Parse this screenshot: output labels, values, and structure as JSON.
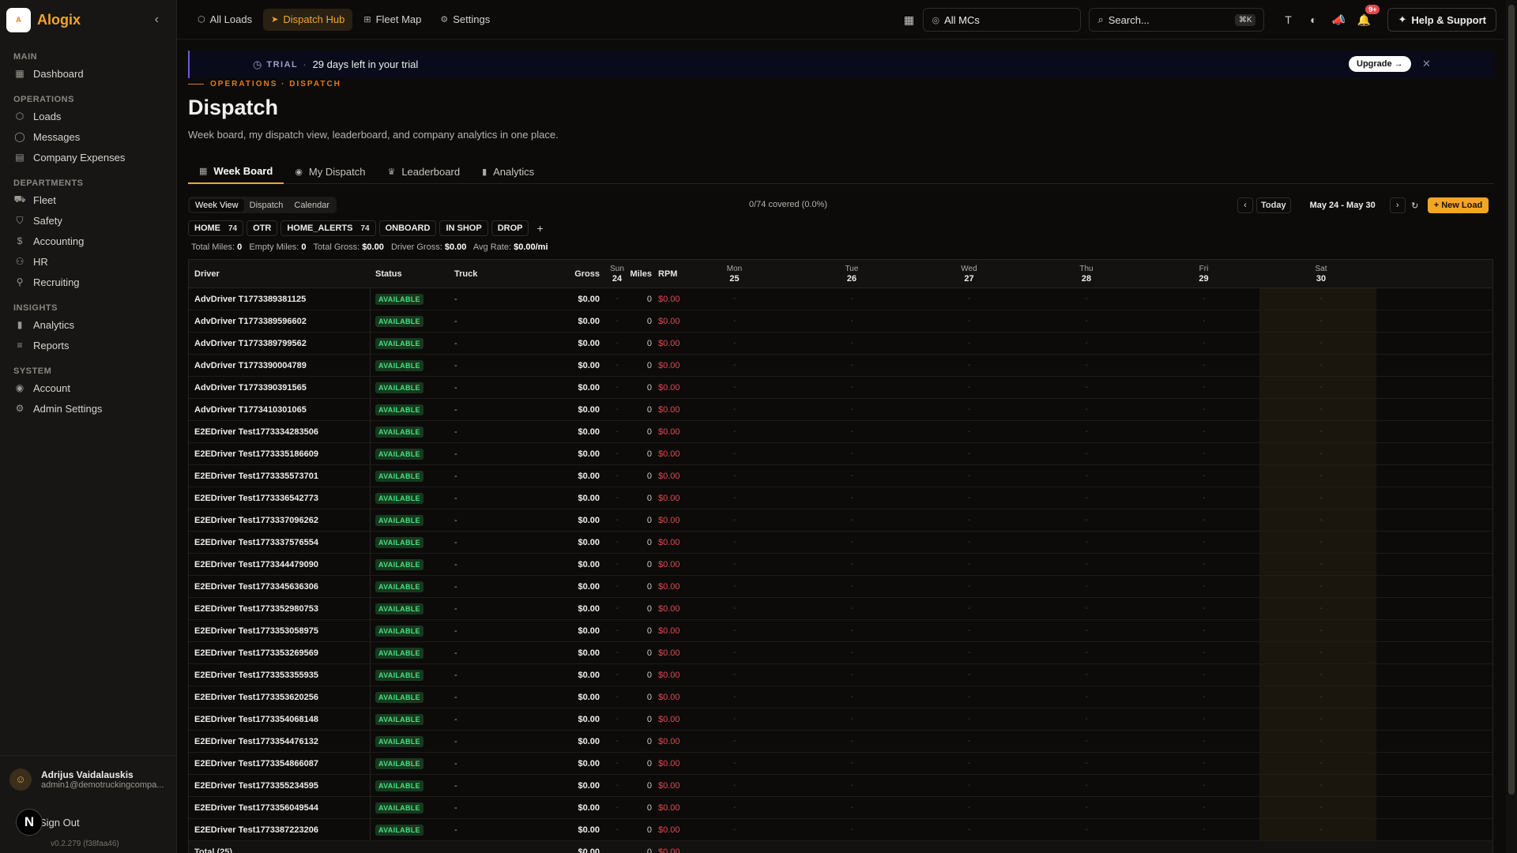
{
  "app": {
    "name": "Alogix",
    "logo_text": "Alogix"
  },
  "sidebar": {
    "sections": [
      {
        "title": "MAIN",
        "items": [
          {
            "label": "Dashboard",
            "icon": "grid-icon"
          }
        ]
      },
      {
        "title": "OPERATIONS",
        "items": [
          {
            "label": "Loads",
            "icon": "package-icon"
          },
          {
            "label": "Messages",
            "icon": "chat-icon"
          },
          {
            "label": "Company Expenses",
            "icon": "receipt-icon"
          }
        ]
      },
      {
        "title": "DEPARTMENTS",
        "items": [
          {
            "label": "Fleet",
            "icon": "truck-icon"
          },
          {
            "label": "Safety",
            "icon": "shield-icon"
          },
          {
            "label": "Accounting",
            "icon": "dollar-icon"
          },
          {
            "label": "HR",
            "icon": "users-icon"
          },
          {
            "label": "Recruiting",
            "icon": "user-plus-icon"
          }
        ]
      },
      {
        "title": "INSIGHTS",
        "items": [
          {
            "label": "Analytics",
            "icon": "bar-chart-icon"
          },
          {
            "label": "Reports",
            "icon": "report-icon"
          }
        ]
      },
      {
        "title": "SYSTEM",
        "items": [
          {
            "label": "Account",
            "icon": "user-circle-icon"
          },
          {
            "label": "Admin Settings",
            "icon": "gear-icon"
          }
        ]
      }
    ],
    "user": {
      "name": "Adrijus Vaidalauskis",
      "email": "admin1@demotruckingcompa..."
    },
    "sign_out": "Sign Out",
    "version": "v0.2.279 (f38faa46)"
  },
  "topnav": {
    "items": [
      {
        "label": "All Loads",
        "icon": "package-icon",
        "active": false
      },
      {
        "label": "Dispatch Hub",
        "icon": "send-icon",
        "active": true
      },
      {
        "label": "Fleet Map",
        "icon": "map-icon",
        "active": false
      },
      {
        "label": "Settings",
        "icon": "gear-icon",
        "active": false
      }
    ],
    "mc_select": "All MCs",
    "search_placeholder": "Search...",
    "search_shortcut": "⌘K",
    "notifications_badge": "9+",
    "help_label": "Help & Support"
  },
  "trial": {
    "tag": "TRIAL",
    "separator": "·",
    "message": "29 days left in your trial",
    "upgrade_label": "Upgrade →"
  },
  "header": {
    "breadcrumb": "OPERATIONS · DISPATCH",
    "title": "Dispatch",
    "subtitle": "Week board, my dispatch view, leaderboard, and company analytics in one place."
  },
  "tabs": [
    {
      "label": "Week Board",
      "icon": "grid-icon",
      "active": true
    },
    {
      "label": "My Dispatch",
      "icon": "user-circle-icon",
      "active": false
    },
    {
      "label": "Leaderboard",
      "icon": "trophy-icon",
      "active": false
    },
    {
      "label": "Analytics",
      "icon": "bar-chart-icon",
      "active": false
    }
  ],
  "view_toggle": [
    {
      "label": "Week View",
      "active": true
    },
    {
      "label": "Dispatch",
      "active": false
    },
    {
      "label": "Calendar",
      "active": false
    }
  ],
  "coverage": "0/74 covered (0.0%)",
  "date_nav": {
    "today": "Today",
    "range": "May 24 - May 30",
    "new_load": "+ New Load"
  },
  "filters": [
    {
      "label": "HOME",
      "count": "74"
    },
    {
      "label": "OTR",
      "count": ""
    },
    {
      "label": "HOME_ALERTS",
      "count": "74"
    },
    {
      "label": "ONBOARD",
      "count": ""
    },
    {
      "label": "IN SHOP",
      "count": ""
    },
    {
      "label": "DROP",
      "count": ""
    }
  ],
  "totals": {
    "total_miles_label": "Total Miles:",
    "total_miles": "0",
    "empty_miles_label": "Empty Miles:",
    "empty_miles": "0",
    "total_gross_label": "Total Gross:",
    "total_gross": "$0.00",
    "driver_gross_label": "Driver Gross:",
    "driver_gross": "$0.00",
    "avg_rate_label": "Avg Rate:",
    "avg_rate": "$0.00/mi"
  },
  "table": {
    "columns": {
      "driver": "Driver",
      "status": "Status",
      "truck": "Truck",
      "gross": "Gross",
      "miles": "Miles",
      "rpm": "RPM"
    },
    "days": [
      {
        "name": "Sun",
        "date": "24"
      },
      {
        "name": "Mon",
        "date": "25"
      },
      {
        "name": "Tue",
        "date": "26"
      },
      {
        "name": "Wed",
        "date": "27"
      },
      {
        "name": "Thu",
        "date": "28"
      },
      {
        "name": "Fri",
        "date": "29"
      },
      {
        "name": "Sat",
        "date": "30"
      }
    ],
    "empty_cell": "-",
    "rows": [
      {
        "driver": "AdvDriver T1773389381125",
        "status": "AVAILABLE",
        "truck": "-",
        "gross": "$0.00",
        "miles": "0",
        "rpm": "$0.00"
      },
      {
        "driver": "AdvDriver T1773389596602",
        "status": "AVAILABLE",
        "truck": "-",
        "gross": "$0.00",
        "miles": "0",
        "rpm": "$0.00"
      },
      {
        "driver": "AdvDriver T1773389799562",
        "status": "AVAILABLE",
        "truck": "-",
        "gross": "$0.00",
        "miles": "0",
        "rpm": "$0.00"
      },
      {
        "driver": "AdvDriver T1773390004789",
        "status": "AVAILABLE",
        "truck": "-",
        "gross": "$0.00",
        "miles": "0",
        "rpm": "$0.00"
      },
      {
        "driver": "AdvDriver T1773390391565",
        "status": "AVAILABLE",
        "truck": "-",
        "gross": "$0.00",
        "miles": "0",
        "rpm": "$0.00"
      },
      {
        "driver": "AdvDriver T1773410301065",
        "status": "AVAILABLE",
        "truck": "-",
        "gross": "$0.00",
        "miles": "0",
        "rpm": "$0.00"
      },
      {
        "driver": "E2EDriver Test1773334283506",
        "status": "AVAILABLE",
        "truck": "-",
        "gross": "$0.00",
        "miles": "0",
        "rpm": "$0.00"
      },
      {
        "driver": "E2EDriver Test1773335186609",
        "status": "AVAILABLE",
        "truck": "-",
        "gross": "$0.00",
        "miles": "0",
        "rpm": "$0.00"
      },
      {
        "driver": "E2EDriver Test1773335573701",
        "status": "AVAILABLE",
        "truck": "-",
        "gross": "$0.00",
        "miles": "0",
        "rpm": "$0.00"
      },
      {
        "driver": "E2EDriver Test1773336542773",
        "status": "AVAILABLE",
        "truck": "-",
        "gross": "$0.00",
        "miles": "0",
        "rpm": "$0.00"
      },
      {
        "driver": "E2EDriver Test1773337096262",
        "status": "AVAILABLE",
        "truck": "-",
        "gross": "$0.00",
        "miles": "0",
        "rpm": "$0.00"
      },
      {
        "driver": "E2EDriver Test1773337576554",
        "status": "AVAILABLE",
        "truck": "-",
        "gross": "$0.00",
        "miles": "0",
        "rpm": "$0.00"
      },
      {
        "driver": "E2EDriver Test1773344479090",
        "status": "AVAILABLE",
        "truck": "-",
        "gross": "$0.00",
        "miles": "0",
        "rpm": "$0.00"
      },
      {
        "driver": "E2EDriver Test1773345636306",
        "status": "AVAILABLE",
        "truck": "-",
        "gross": "$0.00",
        "miles": "0",
        "rpm": "$0.00"
      },
      {
        "driver": "E2EDriver Test1773352980753",
        "status": "AVAILABLE",
        "truck": "-",
        "gross": "$0.00",
        "miles": "0",
        "rpm": "$0.00"
      },
      {
        "driver": "E2EDriver Test1773353058975",
        "status": "AVAILABLE",
        "truck": "-",
        "gross": "$0.00",
        "miles": "0",
        "rpm": "$0.00"
      },
      {
        "driver": "E2EDriver Test1773353269569",
        "status": "AVAILABLE",
        "truck": "-",
        "gross": "$0.00",
        "miles": "0",
        "rpm": "$0.00"
      },
      {
        "driver": "E2EDriver Test1773353355935",
        "status": "AVAILABLE",
        "truck": "-",
        "gross": "$0.00",
        "miles": "0",
        "rpm": "$0.00"
      },
      {
        "driver": "E2EDriver Test1773353620256",
        "status": "AVAILABLE",
        "truck": "-",
        "gross": "$0.00",
        "miles": "0",
        "rpm": "$0.00"
      },
      {
        "driver": "E2EDriver Test1773354068148",
        "status": "AVAILABLE",
        "truck": "-",
        "gross": "$0.00",
        "miles": "0",
        "rpm": "$0.00"
      },
      {
        "driver": "E2EDriver Test1773354476132",
        "status": "AVAILABLE",
        "truck": "-",
        "gross": "$0.00",
        "miles": "0",
        "rpm": "$0.00"
      },
      {
        "driver": "E2EDriver Test1773354866087",
        "status": "AVAILABLE",
        "truck": "-",
        "gross": "$0.00",
        "miles": "0",
        "rpm": "$0.00"
      },
      {
        "driver": "E2EDriver Test1773355234595",
        "status": "AVAILABLE",
        "truck": "-",
        "gross": "$0.00",
        "miles": "0",
        "rpm": "$0.00"
      },
      {
        "driver": "E2EDriver Test1773356049544",
        "status": "AVAILABLE",
        "truck": "-",
        "gross": "$0.00",
        "miles": "0",
        "rpm": "$0.00"
      },
      {
        "driver": "E2EDriver Test1773387223206",
        "status": "AVAILABLE",
        "truck": "-",
        "gross": "$0.00",
        "miles": "0",
        "rpm": "$0.00"
      }
    ],
    "total_row": {
      "driver": "Total (25)",
      "gross": "$0.00",
      "miles": "0",
      "rpm": "$0.00"
    }
  },
  "colors": {
    "accent": "#f5a524",
    "available_text": "#4ade80",
    "available_bg": "#163a1f",
    "rpm_red": "#e5484d",
    "trial_bg": "#090b1a"
  }
}
